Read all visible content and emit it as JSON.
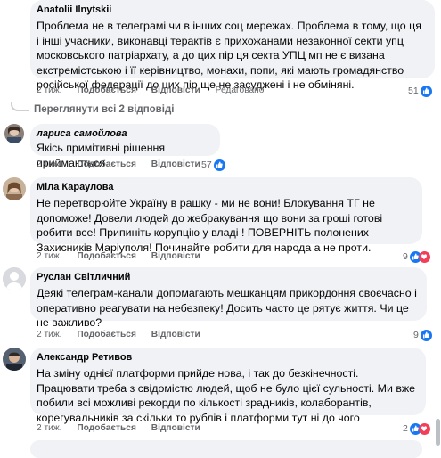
{
  "comments": [
    {
      "author": "Anatolii Ilnytskii",
      "text": "Проблема не в телеграмі чи в інших соц мережах. Проблема в тому, що ця і інші учасники, виконавці терактів є прихожанами незаконної секти упц московського патріархату, а до цих пір ця секта УПЦ мп не є визана екстремістською і її керівництво, монахи, попи, які мають громадянство російської федерації до цих пір ще не засуджені і не обміняні.",
      "time": "2 тиж.",
      "like": "Подобається",
      "reply": "Відповісти",
      "edited": "Редаговано",
      "reactions": "51"
    },
    {
      "author": "лариса самойлова",
      "text": "Якісь примітивні рішення приймаються",
      "time": "2 тиж.",
      "like": "Подобається",
      "reply": "Відповісти",
      "reactions": "57"
    },
    {
      "author": "Міла Караулова",
      "text": "Не перетворюйте Україну в рашку - ми не вони! Блокування ТГ не допоможе! Довели людей до жебракування що вони за гроші готові робити все! Припиніть корупцію у владі ! ПОВЕРНІТЬ полонених Захисників Маріуполя! Починайте робити для народа а не проти.",
      "time": "2 тиж.",
      "like": "Подобається",
      "reply": "Відповісти",
      "reactions": "9"
    },
    {
      "author": "Руслан Світличний",
      "text": "Деякі телеграм-канали допомагають мешканцям прикордоння своєчасно і оперативно реагувати на небезпеку! Досить часто це рятує життя. Чи це не важливо?",
      "time": "2 тиж.",
      "like": "Подобається",
      "reply": "Відповісти",
      "reactions": "9"
    },
    {
      "author": "Александр Ретивов",
      "text": "На зміну однієї платформи прийде нова, і так до безкінечності. Працювати треба з свідомістю людей, щоб не було цієї сульності. Ми вже побили всі можливі рекорди по кількості зрадників, колаборантів, корегувальників за скільки то рублів і платформи тут ні до чого",
      "time": "2 тиж.",
      "like": "Подобається",
      "reply": "Відповісти",
      "reactions": "2"
    }
  ],
  "view_replies": "Переглянути всі 2 відповіді",
  "colors": {
    "like_blue": "#1877f2",
    "bubble": "#f0f2f5",
    "meta": "#65676b"
  }
}
